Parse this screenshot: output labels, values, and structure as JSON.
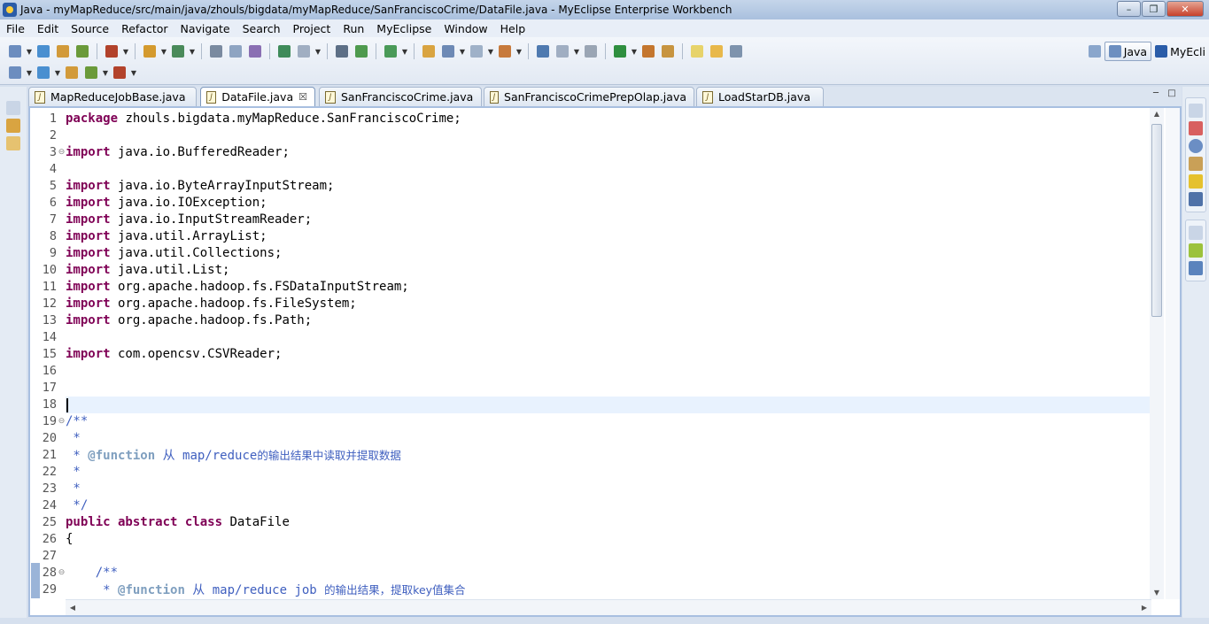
{
  "window": {
    "title": "Java - myMapReduce/src/main/java/zhouls/bigdata/myMapReduce/SanFranciscoCrime/DataFile.java - MyEclipse Enterprise Workbench",
    "minimize_glyph": "–",
    "maximize_glyph": "❐",
    "close_glyph": "✕"
  },
  "menu": [
    "File",
    "Edit",
    "Source",
    "Refactor",
    "Navigate",
    "Search",
    "Project",
    "Run",
    "MyEclipse",
    "Window",
    "Help"
  ],
  "perspectives": {
    "java_label": "Java",
    "myeclipse_label": "MyEcli"
  },
  "tabs": [
    {
      "label": "MapReduceJobBase.java",
      "active": false
    },
    {
      "label": "DataFile.java",
      "active": true,
      "close": "☒"
    },
    {
      "label": "SanFranciscoCrime.java",
      "active": false
    },
    {
      "label": "SanFranciscoCrimePrepOlap.java",
      "active": false
    },
    {
      "label": "LoadStarDB.java",
      "active": false
    }
  ],
  "editor": {
    "current_line": 18,
    "lines": [
      {
        "n": "1",
        "kw": "package",
        "text": " zhouls.bigdata.myMapReduce.SanFranciscoCrime;"
      },
      {
        "n": "2",
        "kw": "",
        "text": ""
      },
      {
        "n": "3",
        "kw": "import",
        "text": " java.io.BufferedReader;",
        "fold": "⊖"
      },
      {
        "n": "4",
        "kw": "",
        "text": ""
      },
      {
        "n": "5",
        "kw": "import",
        "text": " java.io.ByteArrayInputStream;"
      },
      {
        "n": "6",
        "kw": "import",
        "text": " java.io.IOException;"
      },
      {
        "n": "7",
        "kw": "import",
        "text": " java.io.InputStreamReader;"
      },
      {
        "n": "8",
        "kw": "import",
        "text": " java.util.ArrayList;"
      },
      {
        "n": "9",
        "kw": "import",
        "text": " java.util.Collections;"
      },
      {
        "n": "10",
        "kw": "import",
        "text": " java.util.List;"
      },
      {
        "n": "11",
        "kw": "import",
        "text": " org.apache.hadoop.fs.FSDataInputStream;"
      },
      {
        "n": "12",
        "kw": "import",
        "text": " org.apache.hadoop.fs.FileSystem;"
      },
      {
        "n": "13",
        "kw": "import",
        "text": " org.apache.hadoop.fs.Path;"
      },
      {
        "n": "14",
        "kw": "",
        "text": ""
      },
      {
        "n": "15",
        "kw": "import",
        "text": " com.opencsv.CSVReader;"
      },
      {
        "n": "16",
        "kw": "",
        "text": ""
      },
      {
        "n": "17",
        "kw": "",
        "text": ""
      },
      {
        "n": "18",
        "kw": "",
        "text": ""
      },
      {
        "n": "19",
        "comment": "/**",
        "fold": "⊖"
      },
      {
        "n": "20",
        "comment": " *"
      },
      {
        "n": "21",
        "comment": " * ",
        "tag": "@function",
        "comment2": " 从 map/reduce",
        "cjk": "的输出结果中读取并提取数据"
      },
      {
        "n": "22",
        "comment": " *"
      },
      {
        "n": "23",
        "comment": " *"
      },
      {
        "n": "24",
        "comment": " */"
      },
      {
        "n": "25",
        "kw": "public abstract class",
        "text": " DataFile"
      },
      {
        "n": "26",
        "kw": "",
        "text": "{"
      },
      {
        "n": "27",
        "kw": "",
        "text": ""
      },
      {
        "n": "28",
        "comment": "    /**",
        "fold": "⊖"
      },
      {
        "n": "29",
        "comment": "     * ",
        "tag": "@function",
        "comment2": " 从 map/reduce job ",
        "cjk": "的输出结果，提取key值集合"
      }
    ]
  },
  "colors": {
    "keyword": "#7f0055",
    "comment": "#3f5fbf",
    "javadoc_tag": "#7f9fbf",
    "current_line": "#e8f2fe"
  },
  "icons": {
    "toolbar_row1": [
      "new-wizard-icon",
      "save-icon",
      "save-all-icon",
      "print-icon",
      "new-server-icon",
      "open-type-icon",
      "search-icon",
      "deploy-icon",
      "run-server-icon",
      "web-browser-icon",
      "back-nav-icon",
      "forward-nav-icon",
      "new-project-icon",
      "open-web-icon",
      "image-icon",
      "debug-icon",
      "run-icon",
      "coverage-icon",
      "external-tools-icon",
      "new-class-icon",
      "refresh-icon",
      "open-folder-icon",
      "edit-icon",
      "open-package-icon",
      "toggle-mark-icon",
      "highlight-icon",
      "block-select-icon",
      "show-whitespace-icon"
    ],
    "toolbar_row2": [
      "next-annotation-icon",
      "prev-annotation-icon",
      "last-edit-icon",
      "back-icon",
      "forward-icon"
    ]
  }
}
